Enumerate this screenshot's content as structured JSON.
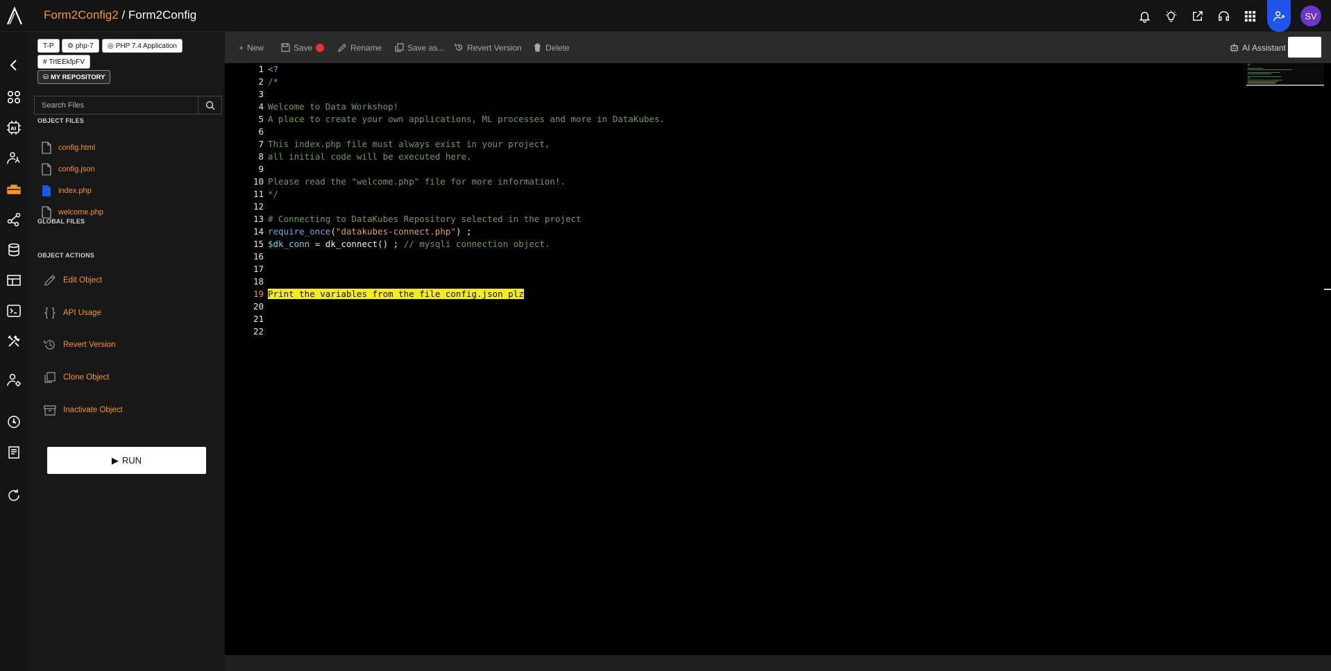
{
  "header": {
    "project": "Form2Config2",
    "separator": " / ",
    "object": "Form2Config",
    "avatar_initials": "SV"
  },
  "top_icons": [
    "bell-icon",
    "lightbulb-icon",
    "share-icon",
    "headset-icon",
    "apps-grid-icon",
    "user-network-icon"
  ],
  "rail_icons": [
    "back-icon",
    "modules-icon",
    "ai-chip-icon",
    "user-graph-icon",
    "toolbox-icon",
    "network-icon",
    "database-icon",
    "table-icon",
    "terminal-icon",
    "tools-icon",
    "user-settings-icon",
    "dashboard-icon",
    "book-icon",
    "refresh-icon"
  ],
  "tags": {
    "tp": "T-P",
    "php": "php-7",
    "app": "PHP 7.4 Application",
    "id": "TrtEEkfpFV",
    "repo": "MY REPOSITORY"
  },
  "search": {
    "placeholder": "Search Files"
  },
  "sections": {
    "object_files": "OBJECT FILES",
    "global_files": "GLOBAL FILES",
    "object_actions": "OBJECT ACTIONS"
  },
  "files": [
    {
      "name": "config.html",
      "active": false
    },
    {
      "name": "config.json",
      "active": false
    },
    {
      "name": "index.php",
      "active": true
    },
    {
      "name": "welcome.php",
      "active": false
    }
  ],
  "actions": {
    "edit": "Edit Object",
    "api": "API Usage",
    "revert": "Revert Version",
    "clone": "Clone Object",
    "inactivate": "Inactivate Object"
  },
  "run_label": "RUN",
  "toolbar": {
    "new": "New",
    "save": "Save",
    "rename": "Rename",
    "save_as": "Save as...",
    "revert": "Revert Version",
    "delete": "Delete",
    "ai": "AI Assistant"
  },
  "editor": {
    "active_line": 19,
    "lines": {
      "l1": "<?",
      "l2": "/*",
      "l4": "Welcome to Data Workshop!",
      "l5": "A place to create your own applications, ML processes and more in DataKubes.",
      "l7": "This index.php file must always exist in your project,",
      "l8": "all initial code will be executed here.",
      "l10": "Please read the \"welcome.php\" file for more information!.",
      "l11": "*/",
      "l13": "# Connecting to DataKubes Repository selected in the project",
      "l14_fn": "require_once",
      "l14_open": "(",
      "l14_str": "\"datakubes-connect.php\"",
      "l14_close": ")",
      "l14_end": " ;",
      "l15_var": "$dk_conn",
      "l15_eq": " = ",
      "l15_fn": "dk_connect",
      "l15_paren": "()",
      "l15_end": " ; ",
      "l15_comment": "// mysqli connection object.",
      "l19": "Print the variables from the file config.json plz"
    }
  }
}
